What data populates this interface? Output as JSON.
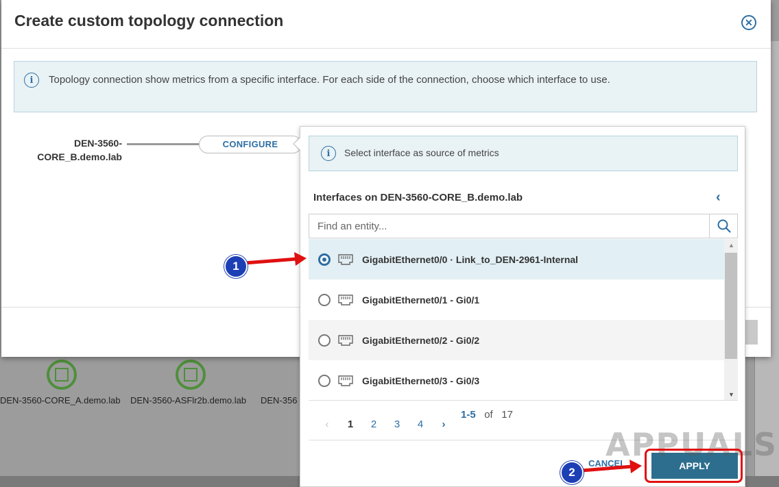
{
  "background": {
    "nodes": [
      {
        "label": "DEN-3560-CORE_A.demo.lab"
      },
      {
        "label": "DEN-3560-ASFlr2b.demo.lab"
      },
      {
        "label": "DEN-356"
      }
    ]
  },
  "modal": {
    "title": "Create custom topology connection",
    "close_icon": "close-circle-icon",
    "info_text": "Topology connection show metrics from a specific interface. For each side of the connection, choose which interface to use.",
    "node_label": "DEN-3560-CORE_B.demo.lab",
    "configure_label": "CONFIGURE"
  },
  "popover": {
    "info_text": "Select interface as source of metrics",
    "title": "Interfaces on DEN-3560-CORE_B.demo.lab",
    "search": {
      "placeholder": "Find an entity...",
      "value": ""
    },
    "interfaces": [
      {
        "label": "GigabitEthernet0/0 · Link_to_DEN-2961-Internal",
        "selected": true
      },
      {
        "label": "GigabitEthernet0/1 - Gi0/1",
        "selected": false
      },
      {
        "label": "GigabitEthernet0/2 - Gi0/2",
        "selected": false
      },
      {
        "label": "GigabitEthernet0/3 - Gi0/3",
        "selected": false
      }
    ],
    "pager": {
      "prev": "‹",
      "pages": [
        "1",
        "2",
        "3",
        "4"
      ],
      "next": "›",
      "current": "1"
    },
    "range": {
      "shown": "1-5",
      "of_label": "of",
      "total": "17"
    },
    "cancel_label": "CANCEL",
    "apply_label": "APPLY"
  },
  "annotations": {
    "step1": "1",
    "step2": "2",
    "watermark": "APPUALS"
  },
  "colors": {
    "accent": "#2d6ea4",
    "apply_bg": "#2d6e8e",
    "annotation_red": "#e01010",
    "badge_blue": "#1d3fb5"
  }
}
